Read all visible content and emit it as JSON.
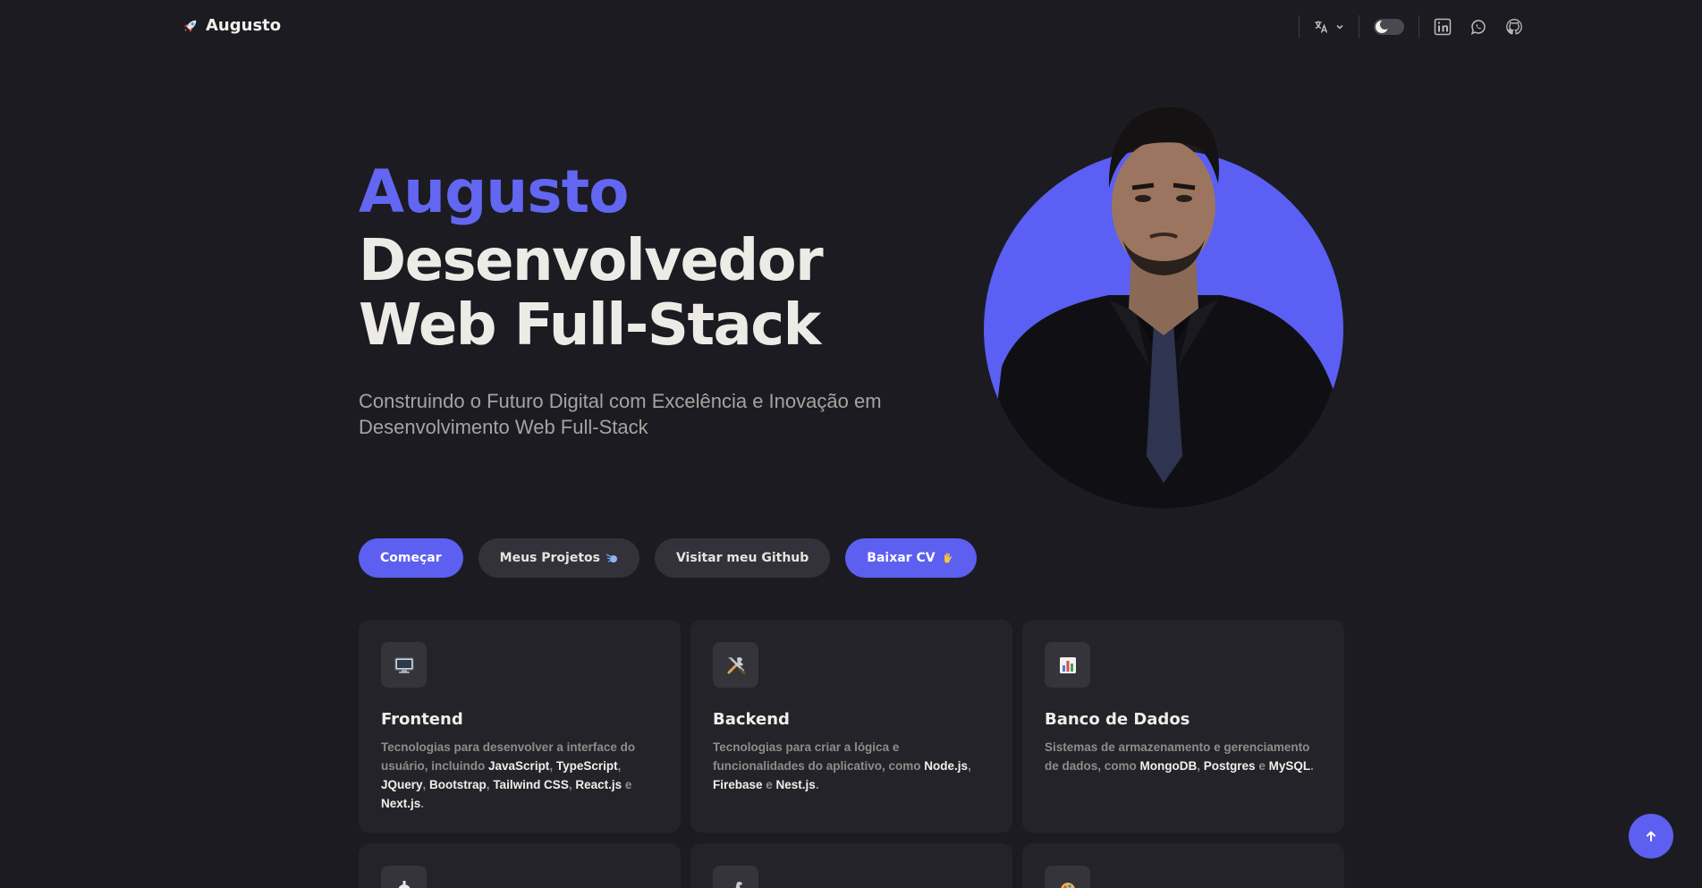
{
  "nav": {
    "brand": "Augusto",
    "brand_icon": "rocket-icon"
  },
  "hero": {
    "name": "Augusto",
    "title_line1": "Desenvolvedor",
    "title_line2": "Web Full-Stack",
    "subtitle": "Construindo o Futuro Digital com Excelência e Inovação em Desenvolvimento Web Full-Stack"
  },
  "buttons": {
    "start": "Começar",
    "projects": "Meus Projetos",
    "github": "Visitar meu Github",
    "cv": "Baixar CV"
  },
  "cards": [
    {
      "icon": "monitor-icon",
      "title": "Frontend",
      "desc_pre": "Tecnologias para desenvolver a interface do usuário, incluindo ",
      "techs": [
        "JavaScript",
        "TypeScript",
        "JQuery",
        "Bootstrap",
        "Tailwind CSS",
        "React.js",
        "Next.js"
      ]
    },
    {
      "icon": "tools-icon",
      "title": "Backend",
      "desc_pre": "Tecnologias para criar a lógica e funcionalidades do aplicativo, como ",
      "techs": [
        "Node.js",
        "Firebase",
        "Nest.js"
      ]
    },
    {
      "icon": "bar-chart-icon",
      "title": "Banco de Dados",
      "desc_pre": "Sistemas de armazenamento e gerenciamento de dados, como ",
      "techs": [
        "MongoDB",
        "Postgres",
        "MySQL"
      ]
    }
  ],
  "card_text": {
    "frontend": {
      "t1": "JavaScript",
      "s1": ", ",
      "t2": "TypeScript",
      "s2": ",",
      "t3": "JQuery",
      "s3": ", ",
      "t4": "Bootstrap",
      "s4": ", ",
      "t5": "Tailwind CSS",
      "s5": ", ",
      "t6": "React.js",
      "s6": " e ",
      "t7": "Next.js",
      "s7": "."
    },
    "backend": {
      "t1": "Node.js",
      "s1": ",",
      "t2": "Firebase",
      "s2": " e ",
      "t3": "Nest.js",
      "s3": "."
    },
    "db": {
      "t1": "MongoDB",
      "s1": ", ",
      "t2": "Postgres",
      "s2": " e ",
      "t3": "MySQL",
      "s3": "."
    }
  },
  "colors": {
    "background": "#1c1b22",
    "accent": "#5d5ff0",
    "card": "#24232a"
  }
}
